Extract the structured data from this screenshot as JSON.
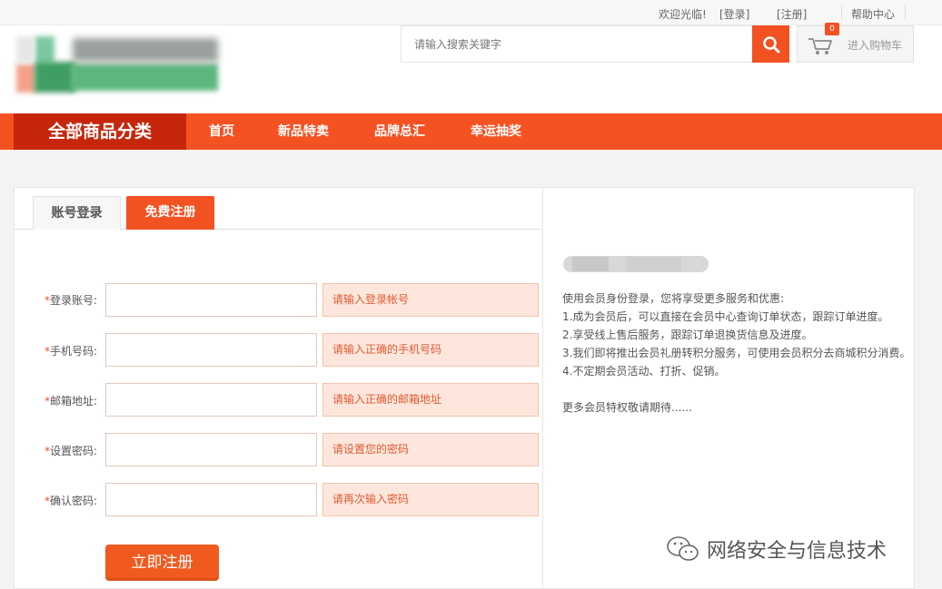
{
  "topbar": {
    "welcome": "欢迎光临!",
    "login": "[登录]",
    "register": "[注册]",
    "help": "帮助中心"
  },
  "header": {
    "search_placeholder": "请输入搜索关键字",
    "search_icon": "search-icon",
    "cart_count": "0",
    "cart_label": "进入购物车",
    "cart_icon": "cart-icon"
  },
  "nav": {
    "all_categories": "全部商品分类",
    "links": [
      "首页",
      "新品特卖",
      "品牌总汇",
      "幸运抽奖"
    ]
  },
  "tabs": {
    "login": "账号登录",
    "register": "免费注册"
  },
  "form": {
    "fields": [
      {
        "label": "登录账号:",
        "hint": "请输入登录帐号"
      },
      {
        "label": "手机号码:",
        "hint": "请输入正确的手机号码"
      },
      {
        "label": "邮箱地址:",
        "hint": "请输入正确的邮箱地址"
      },
      {
        "label": "设置密码:",
        "hint": "请设置您的密码"
      },
      {
        "label": "确认密码:",
        "hint": "请再次输入密码"
      }
    ],
    "required_mark": "*",
    "submit_label": "立即注册"
  },
  "info": {
    "intro": "使用会员身份登录，您将享受更多服务和优惠:",
    "items": [
      "1.成为会员后，可以直接在会员中心查询订单状态，跟踪订单进度。",
      "2.享受线上售后服务，跟踪订单退换货信息及进度。",
      "3.我们即将推出会员礼册转积分服务，可使用会员积分去商城积分消费。",
      "4.不定期会员活动、打折、促销。"
    ],
    "more": "更多会员特权敬请期待......"
  },
  "watermark": {
    "text": "网络安全与信息技术"
  },
  "colors": {
    "accent": "#f25121",
    "nav_dark": "#c6270c",
    "hint_bg": "#fde7dc"
  }
}
